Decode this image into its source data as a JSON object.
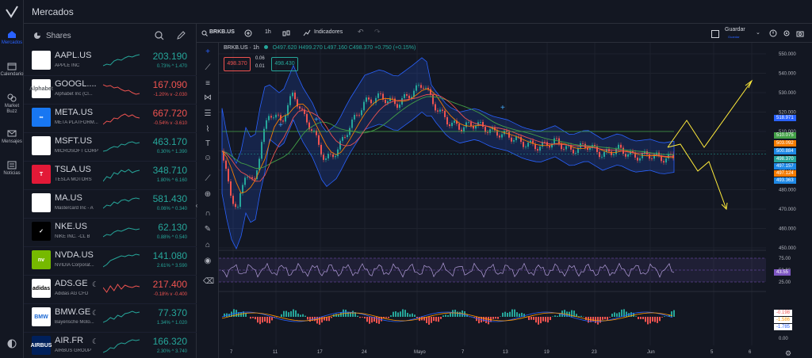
{
  "app": {
    "title": "Mercados"
  },
  "rail": [
    {
      "label": "Mercados",
      "icon": "home-icon"
    },
    {
      "label": "Calendario",
      "icon": "calendar-icon"
    },
    {
      "label": "Market Buzz",
      "icon": "buzz-icon"
    },
    {
      "label": "Mensajes",
      "icon": "mail-icon"
    },
    {
      "label": "Noticias",
      "icon": "news-icon"
    }
  ],
  "watchlist": {
    "header": "Shares",
    "rows": [
      {
        "symbol": "AAPL.US",
        "name": "APPLE INC",
        "price": "203.190",
        "change": "0.73% ^ 1.470",
        "dir": "up",
        "logo_text": "",
        "logo_bg": "#ffffff",
        "logo_fg": "#000000"
      },
      {
        "symbol": "GOOGL....",
        "name": "Alphabet Inc (Cl...",
        "price": "167.090",
        "change": "-1.20% v -2.030",
        "dir": "dn",
        "logo_text": "Alphabet",
        "logo_bg": "#ffffff",
        "logo_fg": "#5f6368"
      },
      {
        "symbol": "META.US",
        "name": "META PLATFORM...",
        "price": "667.720",
        "change": "-0.54% v -3.610",
        "dir": "dn",
        "logo_text": "∞",
        "logo_bg": "#1877f2",
        "logo_fg": "#ffffff"
      },
      {
        "symbol": "MSFT.US",
        "name": "MICROSOFT CORP",
        "price": "463.170",
        "change": "0.30% ^ 1.390",
        "dir": "up",
        "logo_text": "",
        "logo_bg": "#ffffff",
        "logo_fg": "#000000"
      },
      {
        "symbol": "TSLA.US",
        "name": "TESLA MOTORS",
        "price": "348.710",
        "change": "1.80% ^ 6.160",
        "dir": "up",
        "logo_text": "T",
        "logo_bg": "#e31937",
        "logo_fg": "#ffffff"
      },
      {
        "symbol": "MA.US",
        "name": "Mastercard Inc - A",
        "price": "581.430",
        "change": "0.06% ^ 0.340",
        "dir": "up",
        "logo_text": "",
        "logo_bg": "#ffffff",
        "logo_fg": "#000000"
      },
      {
        "symbol": "NKE.US",
        "name": "NIKE INC. -CL B",
        "price": "62.130",
        "change": "0.88% ^ 0.540",
        "dir": "up",
        "logo_text": "✓",
        "logo_bg": "#000000",
        "logo_fg": "#ffffff"
      },
      {
        "symbol": "NVDA.US",
        "name": "NVIDIA Corporat...",
        "price": "141.080",
        "change": "2.61% ^ 3.590",
        "dir": "up",
        "logo_text": "nv",
        "logo_bg": "#76b900",
        "logo_fg": "#ffffff"
      },
      {
        "symbol": "ADS.GE",
        "name": "Adidas AG CFD",
        "price": "217.400",
        "change": "-0.18% v -0.400",
        "dir": "dn",
        "logo_text": "adidas",
        "logo_bg": "#ffffff",
        "logo_fg": "#000000"
      },
      {
        "symbol": "BMW.GE",
        "name": "Bayerische Moto...",
        "price": "77.370",
        "change": "1.34% ^ 1.020",
        "dir": "up",
        "logo_text": "BMW",
        "logo_bg": "#ffffff",
        "logo_fg": "#1c69d4"
      },
      {
        "symbol": "AIR.FR",
        "name": "AIRBUS GROUP",
        "price": "166.320",
        "change": "2.30% ^ 3.740",
        "dir": "up",
        "logo_text": "AIRBUS",
        "logo_bg": "#00205b",
        "logo_fg": "#ffffff"
      }
    ]
  },
  "toolbar": {
    "symbol": "BRKB.US",
    "interval": "1h",
    "indicators": "Indicadores",
    "save": "Guardar",
    "save_sub": "Guardar"
  },
  "legend": {
    "title": "BRKB.US · 1h",
    "o": "O497.620",
    "h": "H499.270",
    "l": "L497.160",
    "c": "C498.370",
    "chg": "+0.750 (+0.15%)",
    "sell": "498.370",
    "buy": "498.430",
    "spread_a": "0.06",
    "spread_b": "0.01"
  },
  "price_axis": [
    "550.000",
    "540.000",
    "530.000",
    "520.000",
    "510.000",
    "500.000",
    "490.000",
    "480.000",
    "470.000",
    "460.000",
    "450.000"
  ],
  "price_tags": [
    {
      "v": "518.971",
      "c": "#2962ff"
    },
    {
      "v": "510.075",
      "c": "#43a047"
    },
    {
      "v": "503.092",
      "c": "#f57c00"
    },
    {
      "v": "500.884",
      "c": "#1e88e5"
    },
    {
      "v": "498.370",
      "c": "#26a69a"
    },
    {
      "v": "497.157",
      "c": "#1e88e5"
    },
    {
      "v": "497.124",
      "c": "#f57c00"
    },
    {
      "v": "493.363",
      "c": "#1e88e5"
    }
  ],
  "rsi_axis": [
    "75.00",
    "50.00",
    "25.00"
  ],
  "rsi_tag": "43.55",
  "macd_tags": [
    "-0.198",
    "-1.586",
    "-1.785"
  ],
  "macd_axis": "0.00",
  "date_axis": [
    "7",
    "11",
    "17",
    "24",
    "Mayo",
    "7",
    "13",
    "19",
    "23",
    "Jun",
    "5",
    "6"
  ]
}
